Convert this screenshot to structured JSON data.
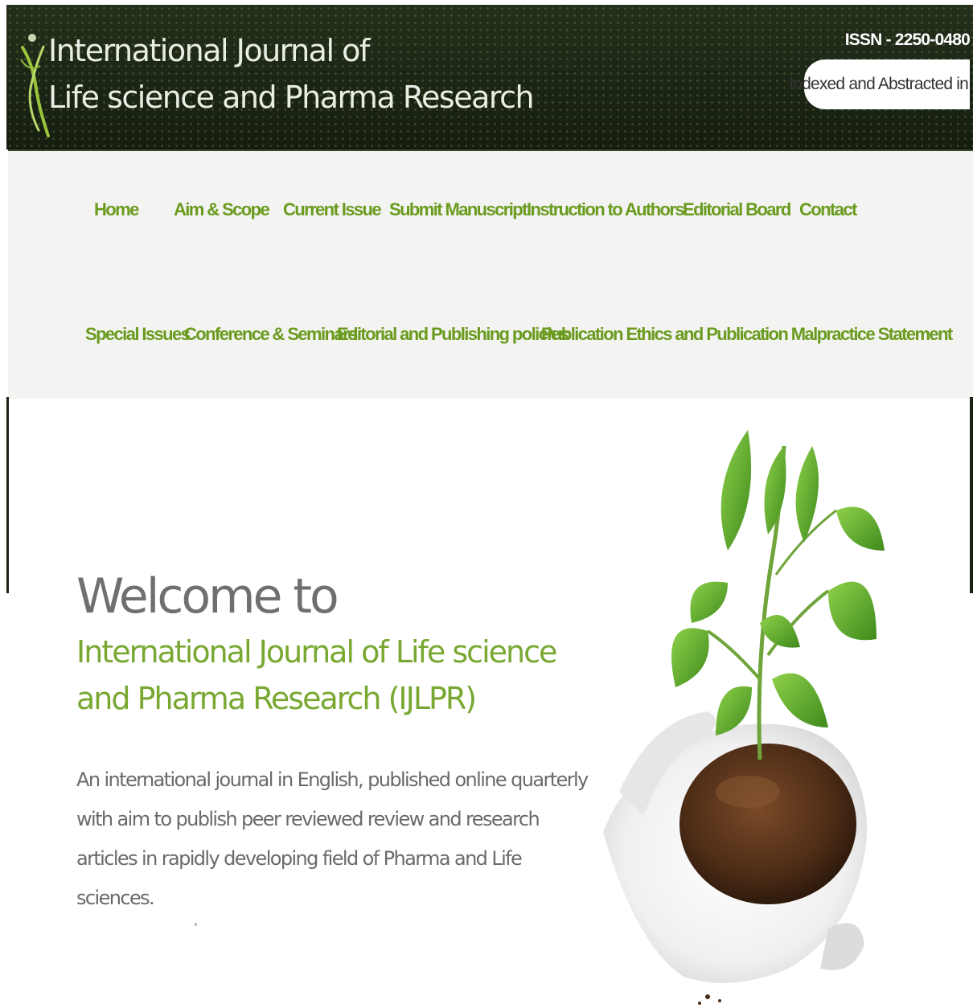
{
  "header": {
    "title_line1": "International Journal of",
    "title_line2": "Life science and Pharma Research",
    "issn": "ISSN - 2250-0480",
    "indexed_label": "Indexed and Abstracted in"
  },
  "nav": {
    "row1": [
      "Home",
      "Aim & Scope",
      "Current Issue",
      "Submit Manuscript",
      "Instruction to Authors",
      "Editorial Board",
      "Contact"
    ],
    "row2": [
      "Special Issues",
      "Conference & Seminars",
      "Editorial and Publishing policies",
      "Publication Ethics and Publication Malpractice Statement"
    ]
  },
  "hero": {
    "welcome": "Welcome to",
    "journal_name": "International Journal of Life science and Pharma Research (IJLPR)",
    "tagline": "An international journal in English, published online quarterly with aim to publish peer reviewed review and research articles in rapidly developing field of Pharma and Life sciences."
  },
  "colors": {
    "header_bg": "#1b2414",
    "nav_link": "#6a9b1f",
    "journal_green": "#79a832",
    "nav_bg": "#f3f3f1"
  }
}
